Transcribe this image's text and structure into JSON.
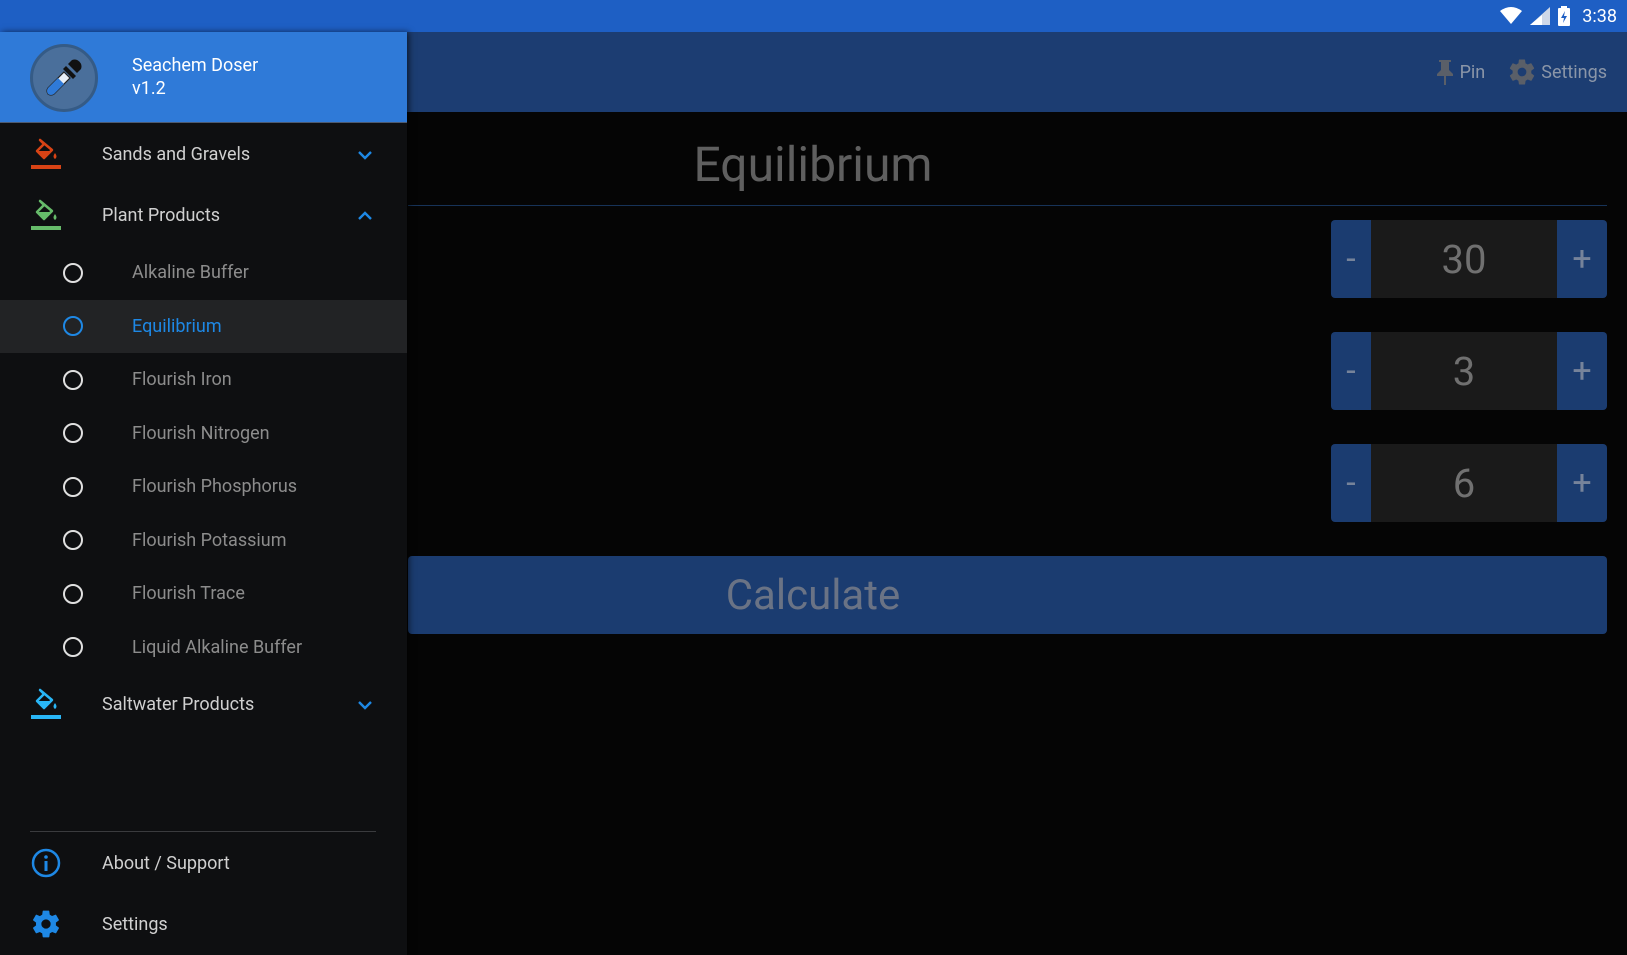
{
  "status_bar": {
    "time": "3:38",
    "icons": [
      "wifi-icon",
      "signal-icon",
      "battery-charging-icon"
    ]
  },
  "app_bar": {
    "actions": [
      {
        "label": "Pin",
        "icon": "pin-icon"
      },
      {
        "label": "Settings",
        "icon": "gear-icon"
      }
    ]
  },
  "main": {
    "title": "Equilibrium",
    "steppers": [
      {
        "minus": "-",
        "value": "30",
        "plus": "+"
      },
      {
        "minus": "-",
        "value": "3",
        "plus": "+"
      },
      {
        "minus": "-",
        "value": "6",
        "plus": "+"
      }
    ],
    "calculate_label": "Calculate"
  },
  "drawer": {
    "app_name": "Seachem Doser",
    "version": "v1.2",
    "groups": [
      {
        "label": "Sands and Gravels",
        "icon": "paint-bucket-icon",
        "color": "#d84315",
        "expanded": false
      },
      {
        "label": "Plant Products",
        "icon": "paint-bucket-icon",
        "color": "#66bb6a",
        "expanded": true
      },
      {
        "label": "Saltwater Products",
        "icon": "paint-bucket-icon",
        "color": "#29b6f6",
        "expanded": false
      }
    ],
    "plant_items": [
      {
        "label": "Alkaline Buffer",
        "selected": false
      },
      {
        "label": "Equilibrium",
        "selected": true
      },
      {
        "label": "Flourish Iron",
        "selected": false
      },
      {
        "label": "Flourish Nitrogen",
        "selected": false
      },
      {
        "label": "Flourish Phosphorus",
        "selected": false
      },
      {
        "label": "Flourish Potassium",
        "selected": false
      },
      {
        "label": "Flourish Trace",
        "selected": false
      },
      {
        "label": "Liquid Alkaline Buffer",
        "selected": false
      }
    ],
    "footer": [
      {
        "label": "About / Support",
        "icon": "info-icon"
      },
      {
        "label": "Settings",
        "icon": "gear-icon"
      }
    ]
  },
  "colors": {
    "accent": "#1e88e5",
    "status_bar": "#1e5fc4",
    "drawer_header": "#2f7ad8"
  }
}
